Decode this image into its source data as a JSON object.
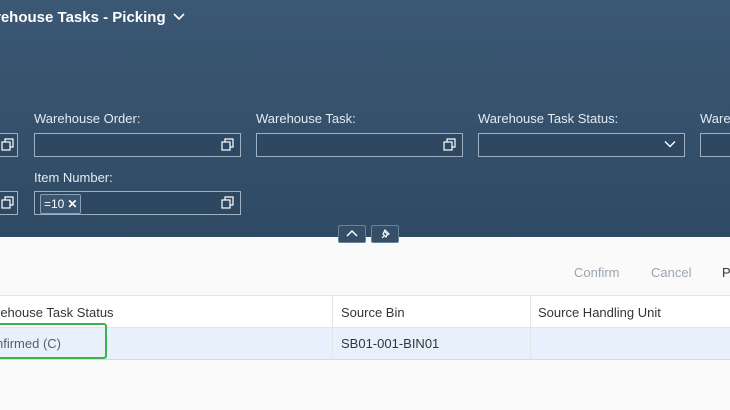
{
  "header": {
    "title": "rehouse Tasks - Picking"
  },
  "filters": {
    "warehouse_order_label": "Warehouse Order:",
    "warehouse_task_label": "Warehouse Task:",
    "warehouse_task_status_label": "Warehouse Task Status:",
    "cut_label": "Ware",
    "item_number_label": "Item Number:",
    "item_number_token": "=10"
  },
  "toolbar": {
    "confirm": "Confirm",
    "cancel": "Cancel",
    "more": "P"
  },
  "table": {
    "columns": [
      "rehouse Task Status",
      "Source Bin",
      "Source Handling Unit"
    ],
    "rows": [
      {
        "status": "nfirmed (C)",
        "source_bin": "SB01-001-BIN01",
        "source_hu": ""
      }
    ]
  },
  "colors": {
    "header_bg": "#35526d",
    "highlight": "#3bb34a",
    "selected_row": "#e8f1fb"
  }
}
